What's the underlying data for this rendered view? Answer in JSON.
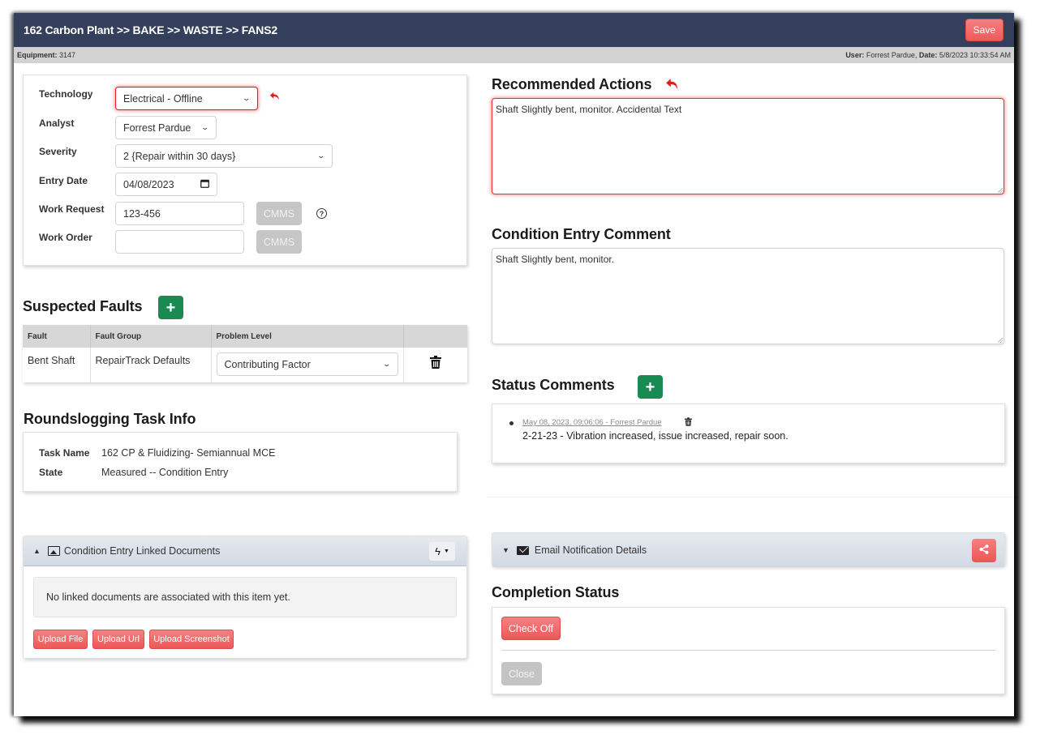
{
  "header": {
    "breadcrumb": "162 Carbon Plant >> BAKE >> WASTE >> FANS2",
    "save_label": "Save"
  },
  "infobar": {
    "equipment_label": "Equipment:",
    "equipment_value": "3147",
    "user_label": "User:",
    "user_value": "Forrest Pardue,",
    "date_label": "Date:",
    "date_value": "5/8/2023 10:33:54 AM"
  },
  "form": {
    "technology": {
      "label": "Technology",
      "value": "Electrical - Offline"
    },
    "analyst": {
      "label": "Analyst",
      "value": "Forrest Pardue"
    },
    "severity": {
      "label": "Severity",
      "value": "2 {Repair within 30 days}"
    },
    "entry_date": {
      "label": "Entry Date",
      "value": "04/08/2023"
    },
    "work_request": {
      "label": "Work Request",
      "value": "123-456",
      "button": "CMMS"
    },
    "work_order": {
      "label": "Work Order",
      "value": "",
      "button": "CMMS"
    }
  },
  "suspected_faults": {
    "title": "Suspected Faults",
    "columns": [
      "Fault",
      "Fault Group",
      "Problem Level",
      ""
    ],
    "rows": [
      {
        "fault": "Bent Shaft",
        "fault_group": "RepairTrack Defaults",
        "problem_level": "Contributing Factor"
      }
    ]
  },
  "task_info": {
    "title": "Roundslogging Task Info",
    "task_name_label": "Task Name",
    "task_name_value": "162 CP & Fluidizing- Semiannual MCE",
    "state_label": "State",
    "state_value": "Measured -- Condition Entry"
  },
  "linked_docs": {
    "title": "Condition Entry Linked Documents",
    "empty_message": "No linked documents are associated with this item yet.",
    "buttons": [
      "Upload File",
      "Upload Url",
      "Upload Screenshot"
    ]
  },
  "recommended_actions": {
    "title": "Recommended Actions",
    "value": "Shaft Slightly bent, monitor. Accidental Text"
  },
  "condition_comment": {
    "title": "Condition Entry Comment",
    "value": "Shaft Slightly bent, monitor."
  },
  "status_comments": {
    "title": "Status Comments",
    "items": [
      {
        "meta": "May 08, 2023, 09:06:06 - Forrest Pardue",
        "text": "2-21-23 - Vibration increased, issue increased, repair soon."
      }
    ]
  },
  "email_notification": {
    "title": "Email Notification Details"
  },
  "completion_status": {
    "title": "Completion Status",
    "check_off_label": "Check Off",
    "close_label": "Close"
  },
  "colors": {
    "header_bg": "#343f5b",
    "accent_red": "#ee5a5a",
    "add_green": "#198a52",
    "invalid_red": "#e6192a"
  }
}
